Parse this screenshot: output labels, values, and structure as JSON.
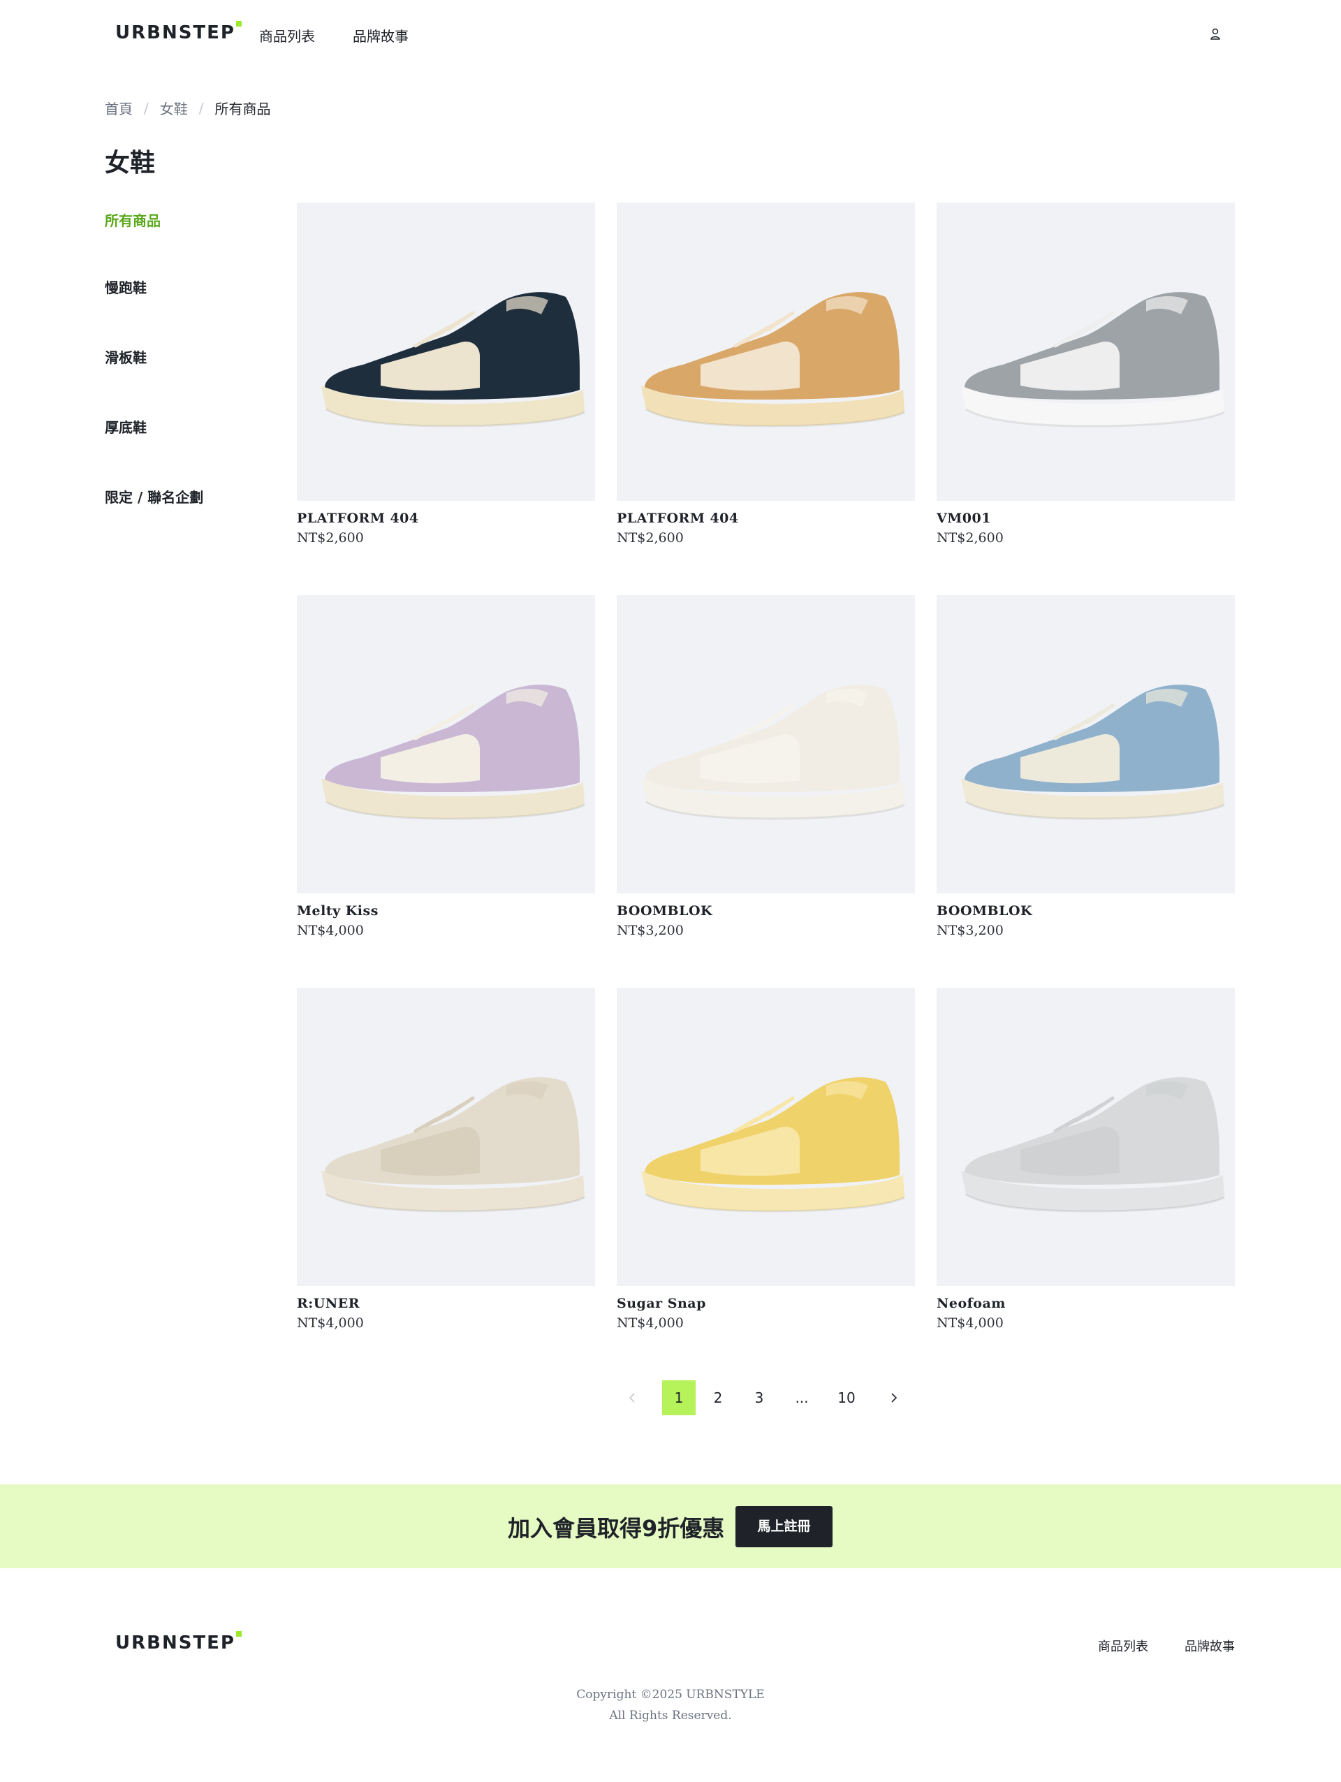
{
  "header": {
    "logo": "URBNSTEP",
    "nav": [
      "商品列表",
      "品牌故事"
    ],
    "user_icon": "user-icon"
  },
  "breadcrumb": [
    "首頁",
    "女鞋",
    "所有商品"
  ],
  "page_title": "女鞋",
  "sidebar": {
    "items": [
      "所有商品",
      "慢跑鞋",
      "滑板鞋",
      "厚底鞋",
      "限定 / 聯名企劃"
    ],
    "active_index": 0
  },
  "products": [
    {
      "name": "PLATFORM 404",
      "price": "NT$2,600",
      "colors": {
        "upper": "#1f2e3d",
        "panel": "#ece4cf",
        "sole": "#efe5c8"
      }
    },
    {
      "name": "PLATFORM 404",
      "price": "NT$2,600",
      "colors": {
        "upper": "#d9a869",
        "panel": "#f2e3cc",
        "sole": "#f1e0b8"
      }
    },
    {
      "name": "VM001",
      "price": "NT$2,600",
      "colors": {
        "upper": "#9ea3a8",
        "panel": "#eeeeee",
        "sole": "#f7f7f7"
      }
    },
    {
      "name": "Melty Kiss",
      "price": "NT$4,000",
      "colors": {
        "upper": "#c9b7d4",
        "panel": "#f4efe4",
        "sole": "#efe6cf"
      }
    },
    {
      "name": "BOOMBLOK",
      "price": "NT$3,200",
      "colors": {
        "upper": "#f1ede4",
        "panel": "#f6f3ec",
        "sole": "#f4f1ea"
      }
    },
    {
      "name": "BOOMBLOK",
      "price": "NT$3,200",
      "colors": {
        "upper": "#8fb1cc",
        "panel": "#edeadc",
        "sole": "#efe9d6"
      }
    },
    {
      "name": "R:UNER",
      "price": "NT$4,000",
      "colors": {
        "upper": "#e3dccd",
        "panel": "#d8cfbd",
        "sole": "#ebe3d3"
      }
    },
    {
      "name": "Sugar Snap",
      "price": "NT$4,000",
      "colors": {
        "upper": "#f0d26a",
        "panel": "#f8e6a6",
        "sole": "#f7e7b2"
      }
    },
    {
      "name": "Neofoam",
      "price": "NT$4,000",
      "colors": {
        "upper": "#d7d9db",
        "panel": "#cfd1d3",
        "sole": "#e3e4e6"
      }
    }
  ],
  "pagination": {
    "prev_icon": "chevron-left-icon",
    "pages": [
      "1",
      "2",
      "3",
      "...",
      "10"
    ],
    "current": "1",
    "next_icon": "chevron-right-icon"
  },
  "promo": {
    "text": "加入會員取得9折優惠",
    "button": "馬上註冊"
  },
  "footer": {
    "logo": "URBNSTEP",
    "links": [
      "商品列表",
      "品牌故事"
    ],
    "copyright_line1": "Copyright ©2025 URBNSTYLE",
    "copyright_line2": "All Rights Reserved."
  },
  "colors": {
    "accent": "#b6f25a",
    "active_text": "#5aa81a",
    "promo_bg": "#e6fbc3",
    "thumb_bg": "#f0f2f6"
  }
}
